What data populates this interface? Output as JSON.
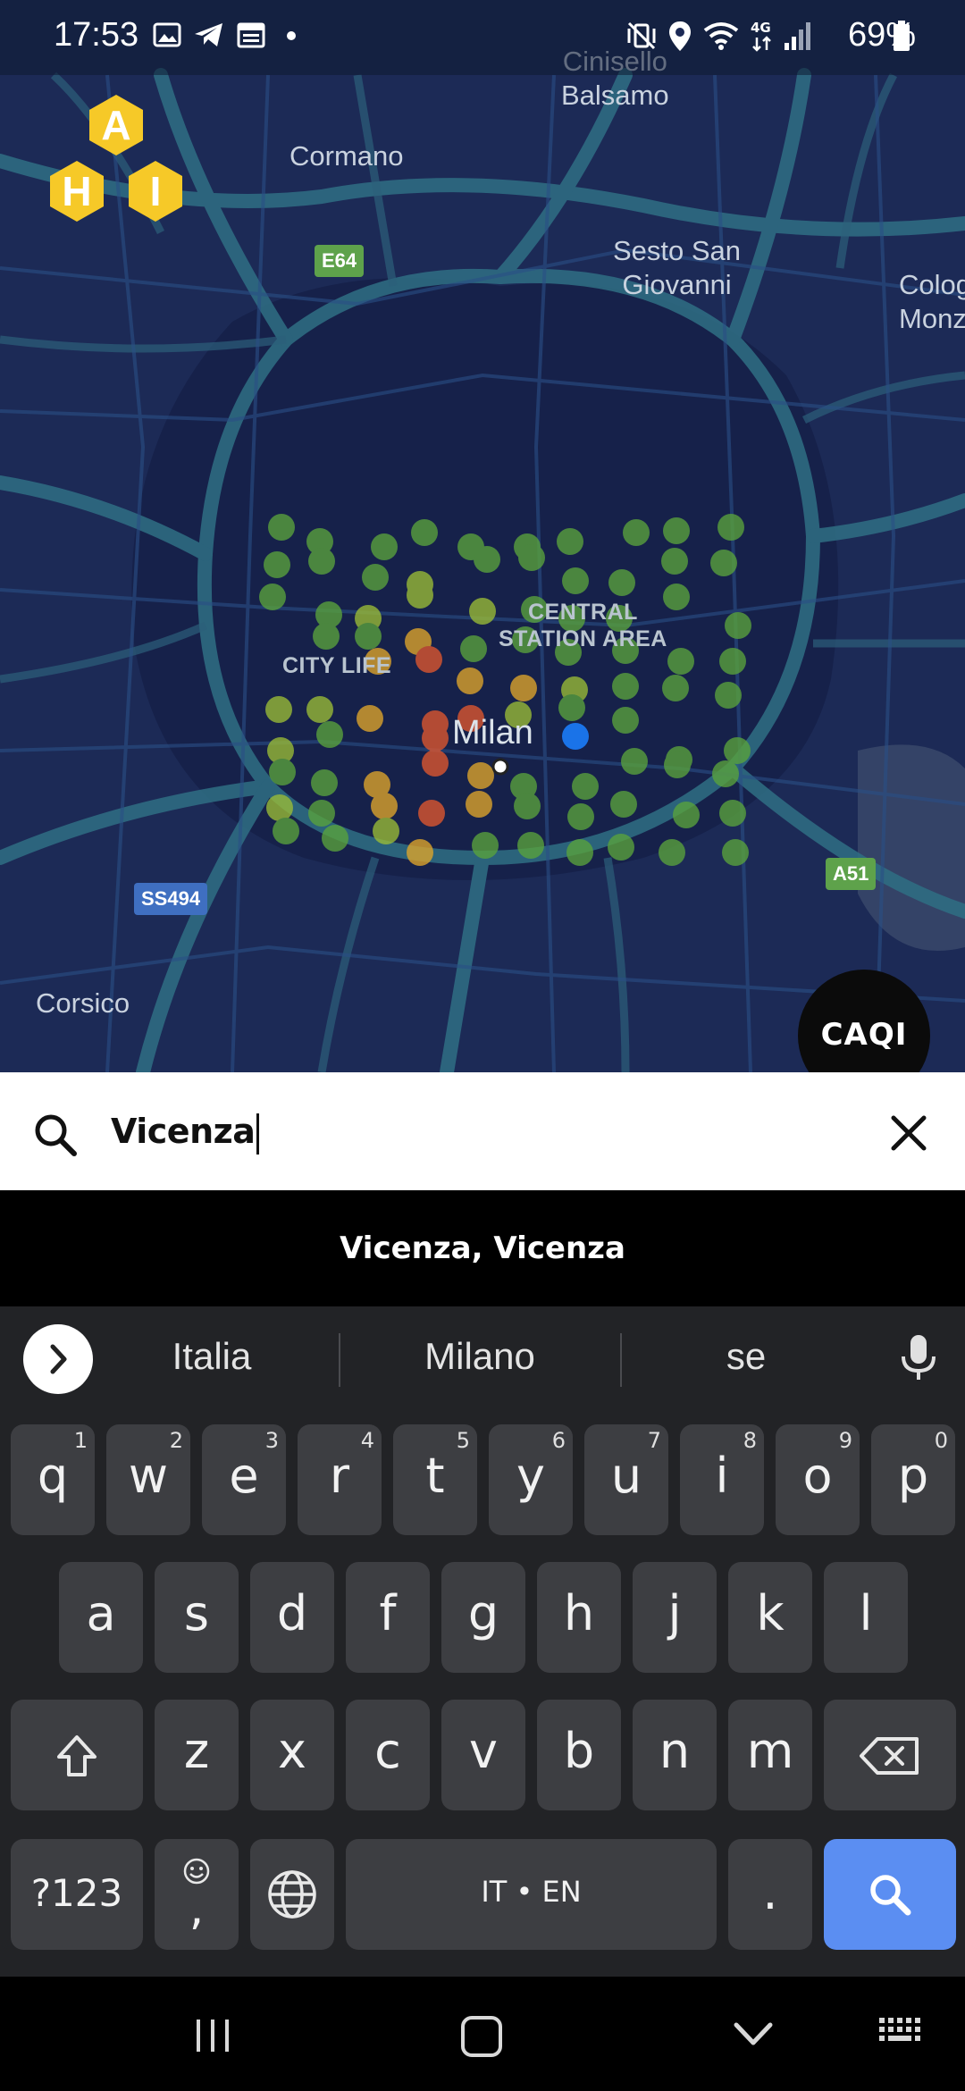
{
  "status_bar": {
    "time": "17:53",
    "battery": "69%",
    "icons": [
      "gallery-icon",
      "telegram-icon",
      "calendar-icon",
      "dot-icon",
      "mute-vibrate-icon",
      "location-icon",
      "wifi-icon",
      "4g-icon",
      "signal-icon",
      "battery-icon"
    ]
  },
  "logo": {
    "letters": [
      "A",
      "H",
      "I"
    ],
    "color": "#f6c928"
  },
  "map": {
    "places": {
      "cinisello": "Cinisello\nBalsamo",
      "cormano": "Cormano",
      "sesto": "Sesto San\nGiovanni",
      "colog": "Colog\nMonz",
      "corsico": "Corsico"
    },
    "districts": {
      "central": "CENTRAL\nSTATION AREA",
      "citylife": "CITY LIFE"
    },
    "city": "Milan",
    "roads": {
      "e64": "E64",
      "ss494": "SS494",
      "a51": "A51"
    },
    "colors": {
      "good": "#5aa33c",
      "fair": "#9bbd36",
      "moderate": "#e0a62a",
      "poor": "#e0582f",
      "user_location": "#1a73e8"
    }
  },
  "caqi_button": {
    "label": "CAQI"
  },
  "search": {
    "value": "Vicenza"
  },
  "suggestion": {
    "label": "Vicenza, Vicenza"
  },
  "keyboard": {
    "suggestions": [
      "Italia",
      "Milano",
      "se"
    ],
    "row1": [
      {
        "key": "q",
        "hint": "1"
      },
      {
        "key": "w",
        "hint": "2"
      },
      {
        "key": "e",
        "hint": "3"
      },
      {
        "key": "r",
        "hint": "4"
      },
      {
        "key": "t",
        "hint": "5"
      },
      {
        "key": "y",
        "hint": "6"
      },
      {
        "key": "u",
        "hint": "7"
      },
      {
        "key": "i",
        "hint": "8"
      },
      {
        "key": "o",
        "hint": "9"
      },
      {
        "key": "p",
        "hint": "0"
      }
    ],
    "row2": [
      "a",
      "s",
      "d",
      "f",
      "g",
      "h",
      "j",
      "k",
      "l"
    ],
    "row3": [
      "z",
      "x",
      "c",
      "v",
      "b",
      "n",
      "m"
    ],
    "symbols": "?123",
    "comma": ",",
    "space": "IT • EN",
    "period": "."
  },
  "nav_bar": {
    "icons": [
      "recent-apps-icon",
      "home-icon",
      "back-icon",
      "keyboard-hide-icon"
    ]
  }
}
